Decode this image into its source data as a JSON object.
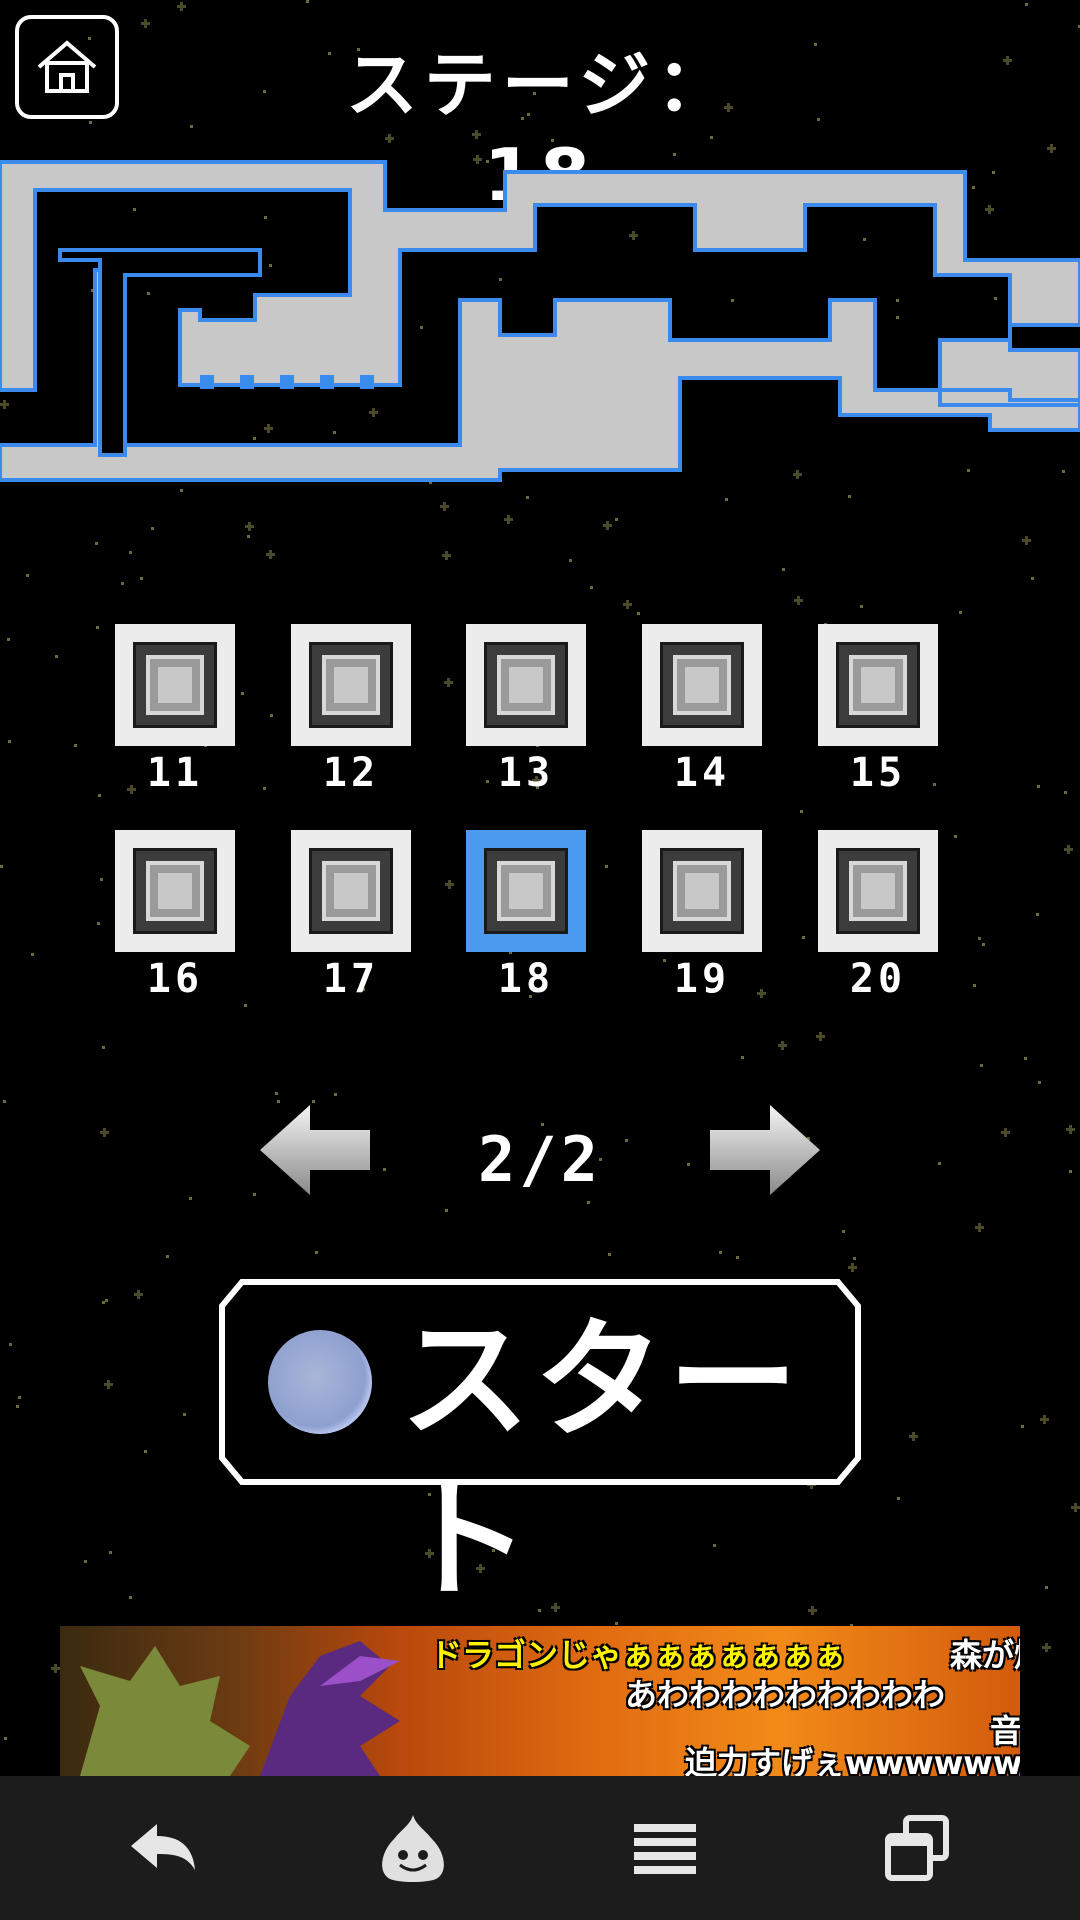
{
  "header": {
    "stage_title": "ステージ：18"
  },
  "stage_grid": {
    "tiles": [
      {
        "label": "11",
        "selected": false
      },
      {
        "label": "12",
        "selected": false
      },
      {
        "label": "13",
        "selected": false
      },
      {
        "label": "14",
        "selected": false
      },
      {
        "label": "15",
        "selected": false
      },
      {
        "label": "16",
        "selected": false
      },
      {
        "label": "17",
        "selected": false
      },
      {
        "label": "18",
        "selected": true
      },
      {
        "label": "19",
        "selected": false
      },
      {
        "label": "20",
        "selected": false
      }
    ]
  },
  "pager": {
    "indicator": "2/2",
    "prev_icon": "left-arrow-icon",
    "next_icon": "right-arrow-icon"
  },
  "start_button": {
    "label": "スタート"
  },
  "ad": {
    "line1": "ドラゴンじゃぁぁぁぁぁぁぁ",
    "line1b": "森が燃",
    "line2": "あわわわわわわわわわ",
    "line2b": "音",
    "line3": "迫力すげぇwwwwwwww"
  },
  "navbar": {
    "items": [
      "back-icon",
      "slime-icon",
      "menu-icon",
      "recent-apps-icon"
    ]
  },
  "colors": {
    "selected_tile": "#4a9bf0",
    "maze_wall": "#c8c8c8",
    "maze_edge": "#3b8bef",
    "background": "#000000"
  }
}
